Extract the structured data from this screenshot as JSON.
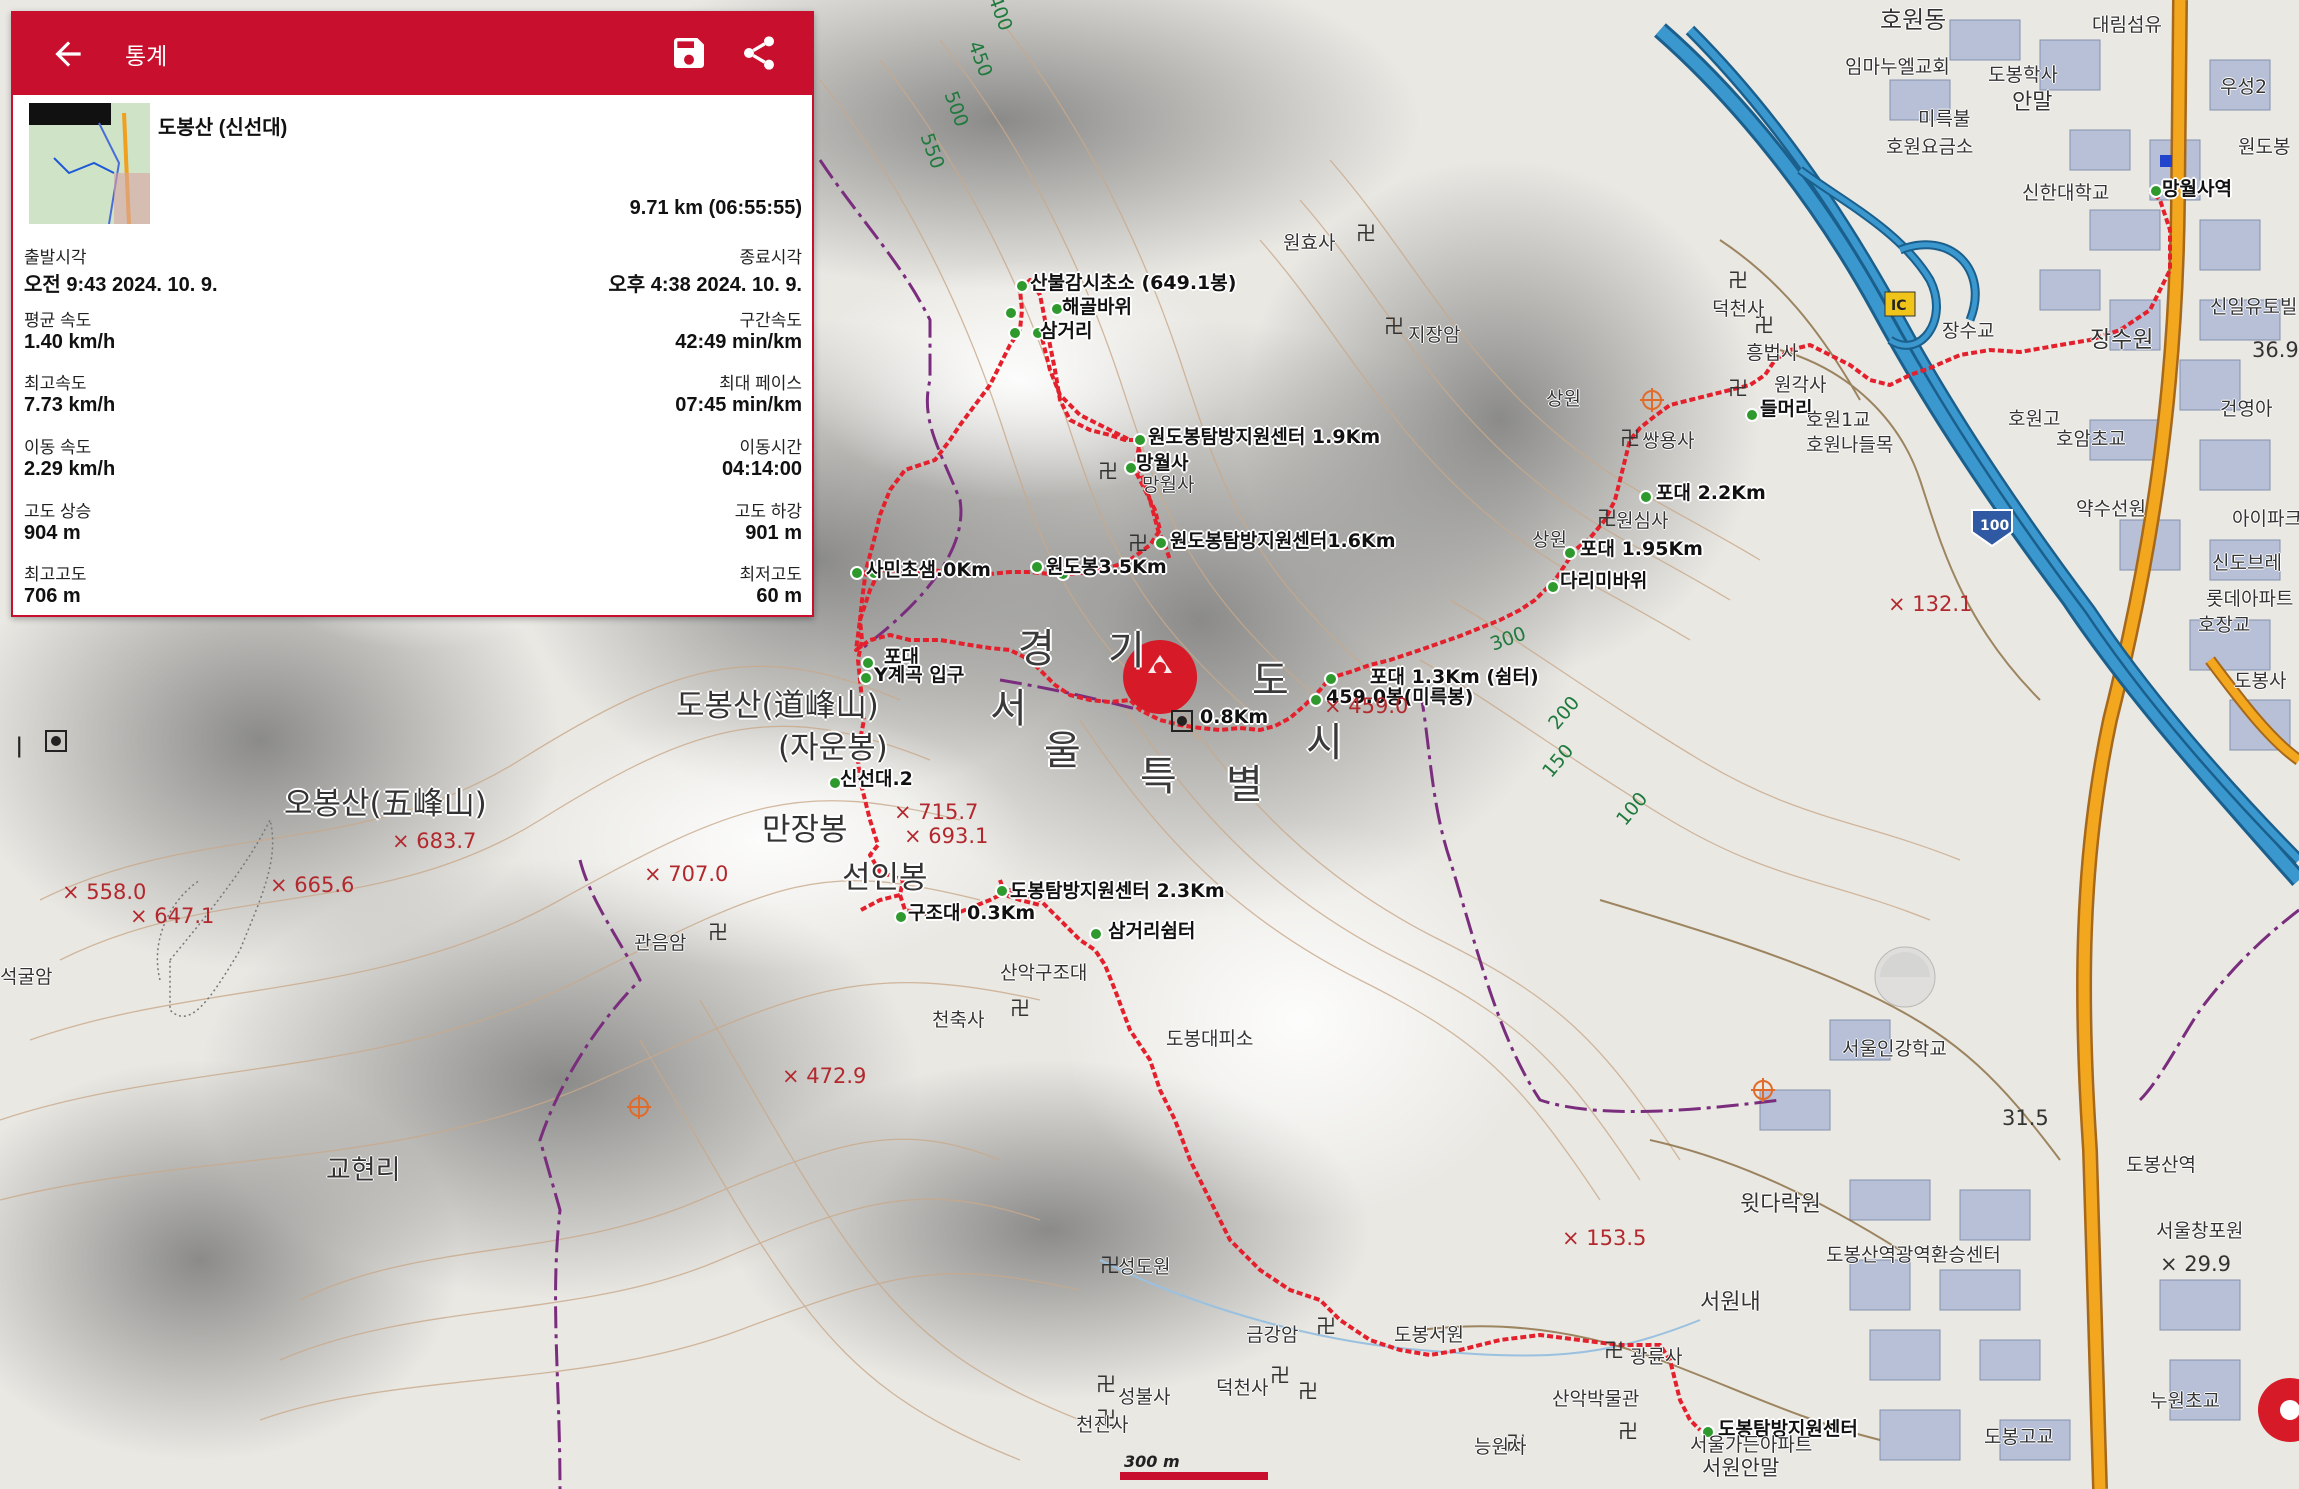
{
  "panel": {
    "title": "통계",
    "back_icon": "arrow-left-icon",
    "save_icon": "floppy-disk-icon",
    "share_icon": "share-icon",
    "route_name": "도봉산 (신선대)",
    "distance": "9.71 km (06:55:55)",
    "stats": [
      {
        "left_label": "출발시각",
        "left_value": "오전 9:43 2024. 10. 9.",
        "right_label": "종료시각",
        "right_value": "오후 4:38 2024. 10. 9."
      },
      {
        "left_label": "평균 속도",
        "left_value": "1.40 km/h",
        "right_label": "구간속도",
        "right_value": "42:49 min/km"
      },
      {
        "left_label": "최고속도",
        "left_value": "7.73 km/h",
        "right_label": "최대 페이스",
        "right_value": "07:45 min/km"
      },
      {
        "left_label": "이동 속도",
        "left_value": "2.29 km/h",
        "right_label": "이동시간",
        "right_value": "04:14:00"
      },
      {
        "left_label": "고도 상승",
        "left_value": "904 m",
        "right_label": "고도 하강",
        "right_value": "901 m"
      },
      {
        "left_label": "최고고도",
        "left_value": "706 m",
        "right_label": "최저고도",
        "right_value": "60 m"
      }
    ]
  },
  "waypoints": {
    "w1": "산불감시초소 (649.1봉)",
    "w2": "해골바위",
    "w3": "삼거리",
    "w4": "원도봉탐방지원센터 1.9Km",
    "w5": "망월사",
    "w6": "원도봉탐방지원센터1.6Km",
    "w7": "원도봉3.5Km",
    "w8": "사민초샘.0Km",
    "w9": "포대",
    "w10": "Y계곡 입구",
    "w11": "신선대.2",
    "w12": "도봉탐방지원센터 2.3Km",
    "w13": "구조대 0.3Km",
    "w14": "삼거리쉼터",
    "w15": "0.8Km",
    "w16": "포대 1.3Km (쉼터)",
    "w17": "459.0봉(미륵봉)",
    "w18": "포대 2.2Km",
    "w19": "포대 1.95Km",
    "w20": "다리미바위",
    "w21": "들머리",
    "w22": "도봉탐방지원센터",
    "w23": "망월사역"
  },
  "places": {
    "p1": "원효사",
    "p2": "지장암",
    "p3": "망월사",
    "p4": "원심사",
    "p5": "상원",
    "p6": "쌍용사",
    "p7": "흥법사",
    "p8": "덕천사",
    "p9": "원각사",
    "p10": "호원1교",
    "p11": "호원나들목",
    "p12": "도봉대피소",
    "p13": "천축사",
    "p14": "산악구조대",
    "p15": "관음암",
    "p16": "석굴암",
    "p17": "성도원",
    "p18": "성불사",
    "p19": "천진사",
    "p20": "금강암",
    "p21": "도봉서원",
    "p22": "광륜사",
    "p23": "산악박물관",
    "p24": "능원사",
    "p25": "서원안말",
    "p26": "서원내",
    "p27": "윗다락원",
    "p28": "서울인강학교",
    "p29": "도봉산역광역환승센터",
    "p30": "도봉산역",
    "p31": "서울창포원",
    "p32": "신한대학교",
    "p33": "망월사역",
    "p34": "임마누엘교회",
    "p35": "호원요금소",
    "p36": "미륵불",
    "p37": "도봉학사",
    "p38": "장수교",
    "p39": "장수원",
    "p40": "호원고",
    "p41": "호암초교",
    "p42": "약수선원",
    "p43": "교현리",
    "p44": "덕천사",
    "p45": "도봉고교",
    "p46": "누원초교",
    "p47": "대림섬유",
    "p48": "호원동",
    "p49": "안말",
    "p50": "서울가든아파트",
    "p51": "우성2",
    "p52": "원도봉",
    "p53": "신일유토빌",
    "p54": "건영아",
    "p55": "아이파크",
    "p56": "신도브레",
    "p57": "롯데아파트",
    "p58": "호장교",
    "p59": "도봉사",
    "p60": "IC",
    "p61": "상원"
  },
  "peaks": {
    "k1": "도봉산(道峰山)",
    "k2": "(자운봉)",
    "k3": "만장봉",
    "k4": "선인봉",
    "k5": "오봉산(五峰山)"
  },
  "city_label": [
    "경",
    "기",
    "도",
    "서",
    "울",
    "특",
    "별",
    "시"
  ],
  "elevations": [
    "683.7",
    "558.0",
    "647.1",
    "665.6",
    "707.0",
    "715.7",
    "693.1",
    "472.9",
    "459.0",
    "132.1",
    "153.5",
    "31.5",
    "29.9",
    "36.9"
  ],
  "contours": [
    "400",
    "450",
    "500",
    "550",
    "300",
    "200",
    "150",
    "100"
  ],
  "scale": {
    "label": "300 m"
  },
  "colors": {
    "brand": "#c8102e",
    "track": "#e4202c",
    "waypoint": "#2e9a2e",
    "highway": "#2f8fc9",
    "road": "#f0a01e",
    "elevation": "#b3282d",
    "boundary": "#7a2d7d"
  }
}
